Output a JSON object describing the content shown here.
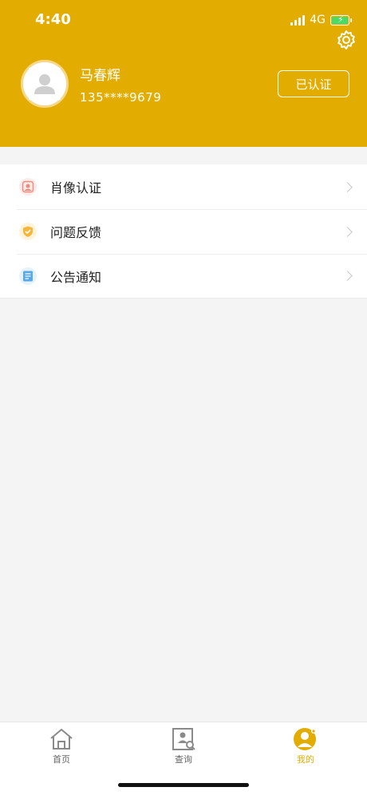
{
  "status_bar": {
    "time": "4:40",
    "network": "4G"
  },
  "profile": {
    "name": "马春辉",
    "phone": "135****9679",
    "cert_label": "已认证"
  },
  "menu": {
    "items": [
      {
        "label": "肖像认证",
        "icon": "portrait-icon",
        "color": "#f08a7c"
      },
      {
        "label": "问题反馈",
        "icon": "feedback-shield-icon",
        "color": "#f5b63a"
      },
      {
        "label": "公告通知",
        "icon": "notice-icon",
        "color": "#5aa9e6"
      }
    ]
  },
  "tabbar": {
    "tabs": [
      {
        "label": "首页",
        "icon": "home-icon"
      },
      {
        "label": "查询",
        "icon": "query-icon"
      },
      {
        "label": "我的",
        "icon": "profile-icon",
        "active": true
      }
    ]
  },
  "colors": {
    "accent": "#e2ad00",
    "background": "#f4f4f4"
  }
}
